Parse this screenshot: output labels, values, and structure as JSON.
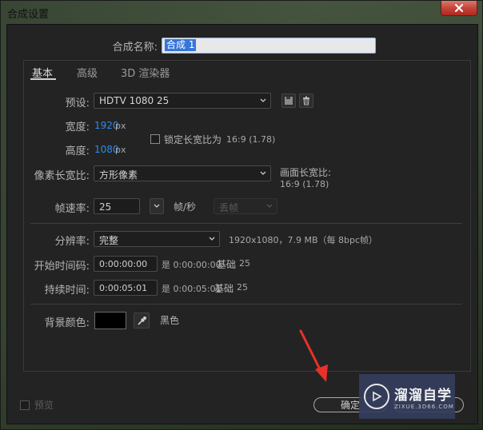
{
  "window": {
    "title": "合成设置"
  },
  "comp_name": {
    "label": "合成名称:",
    "value": "合成 1"
  },
  "tabs": [
    {
      "label": "基本",
      "active": true
    },
    {
      "label": "高级",
      "active": false
    },
    {
      "label": "3D 渲染器",
      "active": false
    }
  ],
  "preset": {
    "label": "预设:",
    "value": "HDTV 1080 25"
  },
  "width": {
    "label": "宽度:",
    "value": "1920",
    "unit": "px"
  },
  "height": {
    "label": "高度:",
    "value": "1080",
    "unit": "px"
  },
  "lock_aspect": {
    "label": "锁定长宽比为",
    "ratio": "16:9 (1.78)",
    "checked": false
  },
  "pixel_aspect": {
    "label": "像素长宽比:",
    "value": "方形像素"
  },
  "frame_aspect": {
    "label": "画面长宽比:",
    "value": "16:9 (1.78)"
  },
  "frame_rate": {
    "label": "帧速率:",
    "value": "25",
    "unit": "帧/秒",
    "drop_frame": "丢帧"
  },
  "resolution": {
    "label": "分辨率:",
    "value": "完整",
    "info": "1920x1080，7.9 MB（每 8bpc帧）"
  },
  "start_timecode": {
    "label": "开始时间码:",
    "value": "0:00:00:00",
    "equals": "是 0:00:00:00",
    "base_label": "基础",
    "base": "25"
  },
  "duration": {
    "label": "持续时间:",
    "value": "0:00:05:01",
    "equals": "是 0:00:05:01",
    "base_label": "基础",
    "base": "25"
  },
  "background": {
    "label": "背景颜色:",
    "color_name": "黑色",
    "color": "#000000"
  },
  "preview": {
    "label": "预览"
  },
  "buttons": {
    "ok": "确定"
  },
  "watermark": {
    "main": "溜溜自学",
    "sub": "ZIXUE.3D66.COM"
  },
  "colors": {
    "accent_blue": "#2d8ceb",
    "selection": "#3875d7",
    "arrow_red": "#e8312a"
  }
}
